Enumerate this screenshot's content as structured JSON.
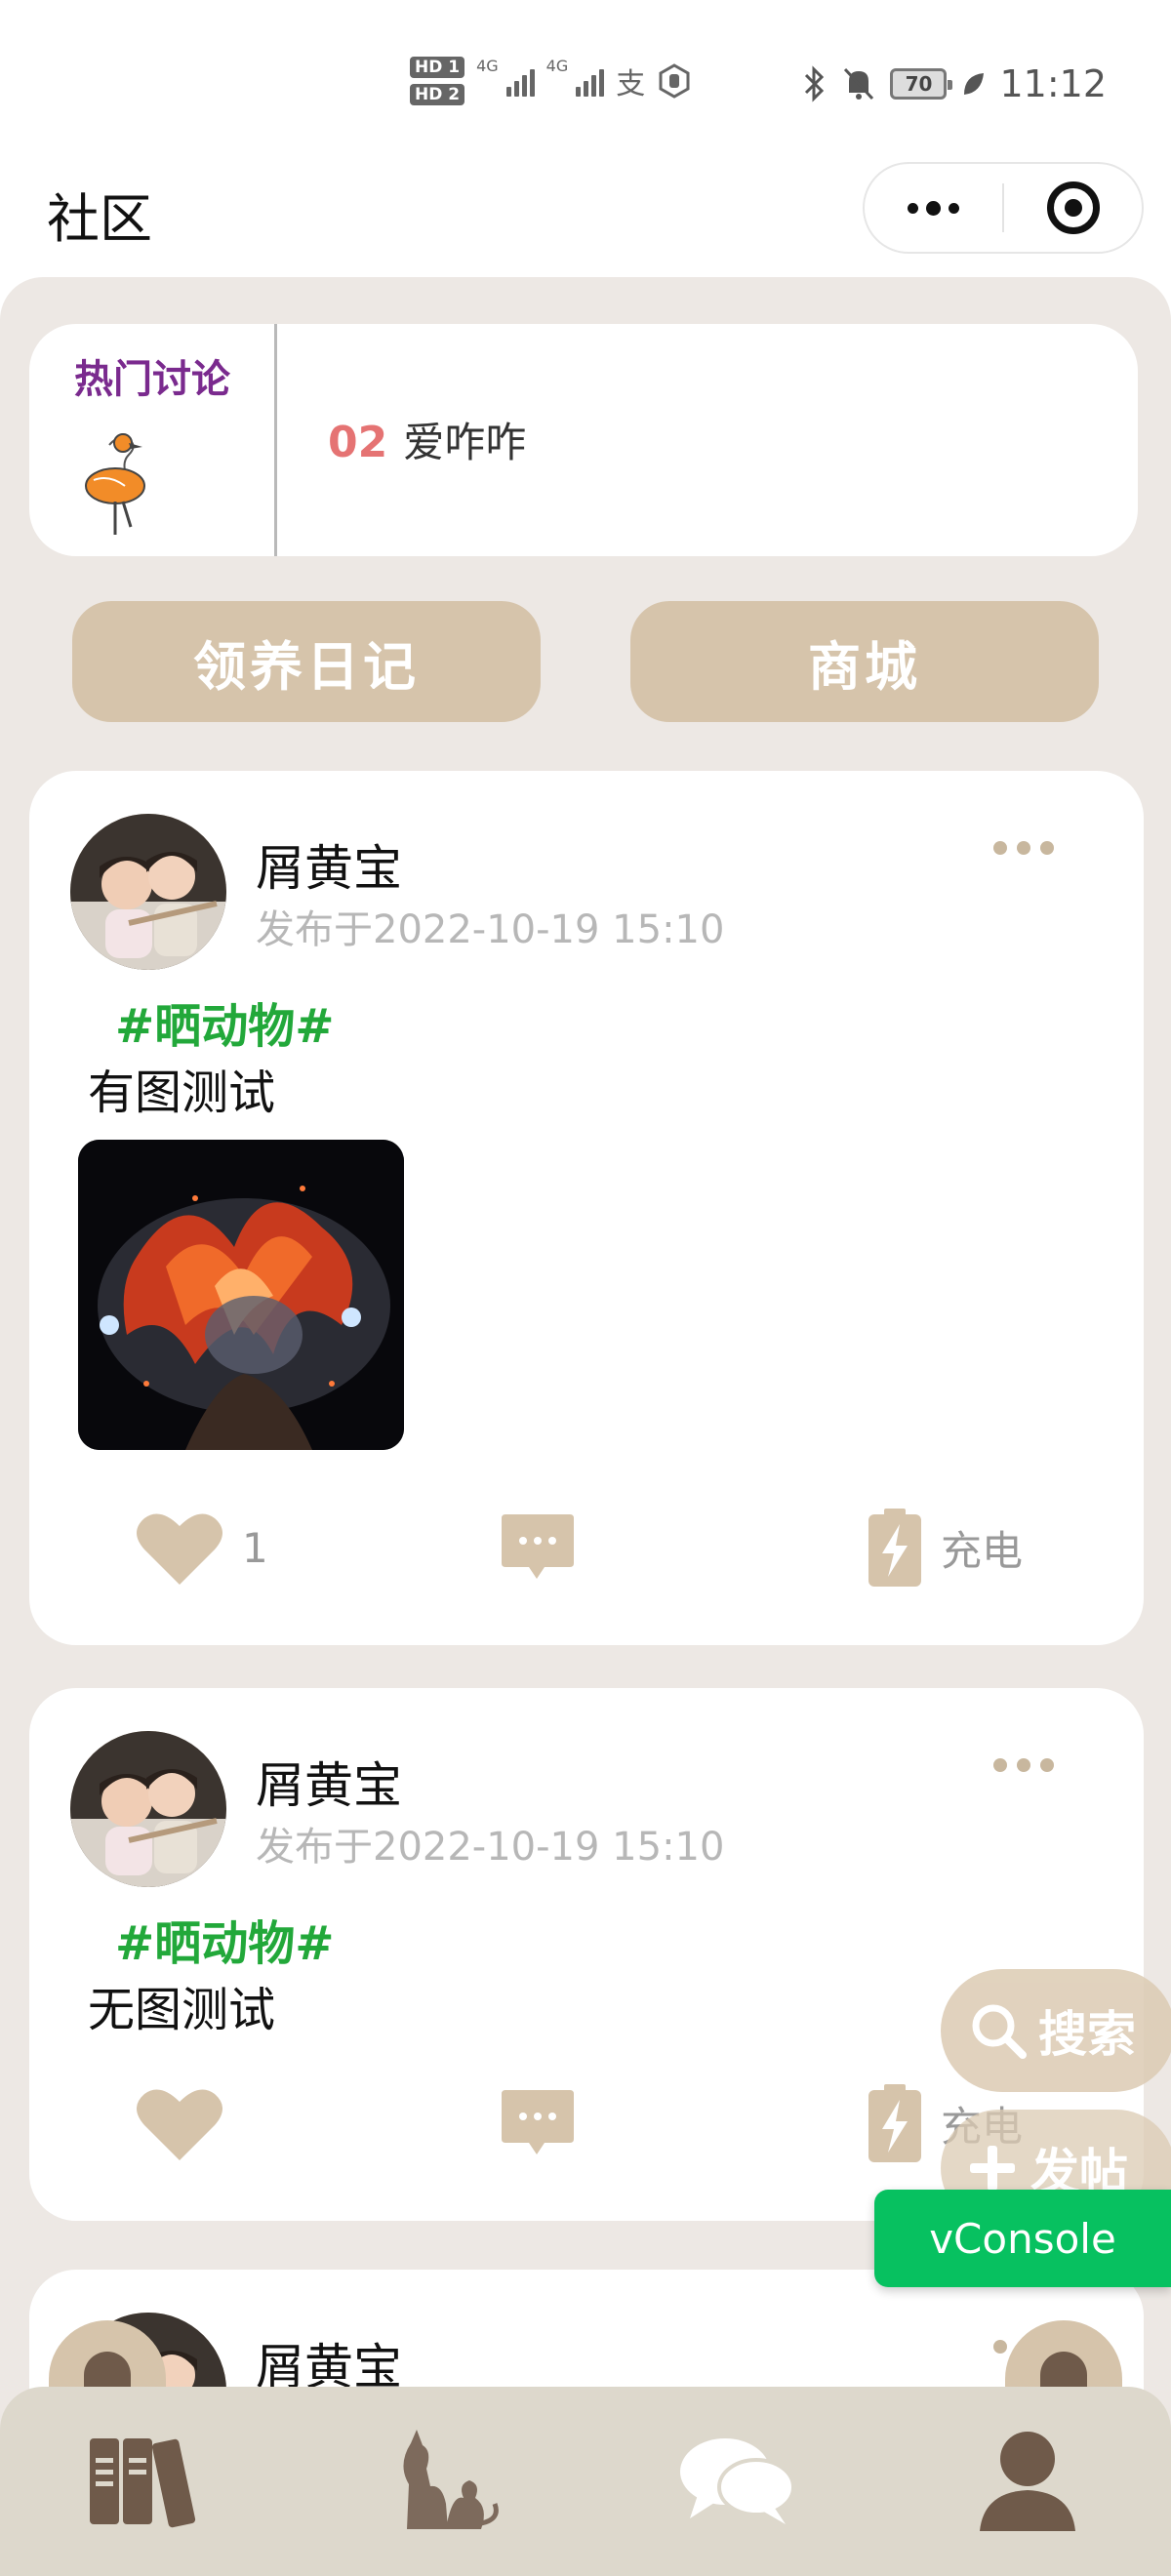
{
  "status_bar": {
    "hd1": "HD 1",
    "hd2": "HD 2",
    "net1": "4G",
    "net2": "4G",
    "battery": "70",
    "time": "11:12"
  },
  "header": {
    "title": "社区"
  },
  "hot_topics": {
    "title": "热门讨论",
    "items": [
      {
        "rank": "02",
        "text": "爱咋咋"
      }
    ]
  },
  "quick_buttons": {
    "adopt_diary": "领养日记",
    "mall": "商城"
  },
  "posts": [
    {
      "author": "屑黄宝",
      "time": "发布于2022-10-19 15:10",
      "tag": "#晒动物#",
      "content": "有图测试",
      "likes": "1",
      "charge_label": "充电"
    },
    {
      "author": "屑黄宝",
      "time": "发布于2022-10-19 15:10",
      "tag": "#晒动物#",
      "content": "无图测试",
      "likes": "",
      "charge_label": "充电"
    },
    {
      "author": "屑黄宝"
    }
  ],
  "floating": {
    "search_label": "搜索",
    "post_label": "发帖",
    "vconsole_label": "vConsole"
  },
  "colors": {
    "accent": "#d6c4ab",
    "tag_green": "#22a83a",
    "hot_title_purple": "#7a2a8e",
    "rank_red": "#e57373",
    "vconsole_green": "#07c160"
  },
  "tab_bar": {
    "icons": [
      "books-icon",
      "pet-icon",
      "chat-icon",
      "user-icon"
    ]
  }
}
